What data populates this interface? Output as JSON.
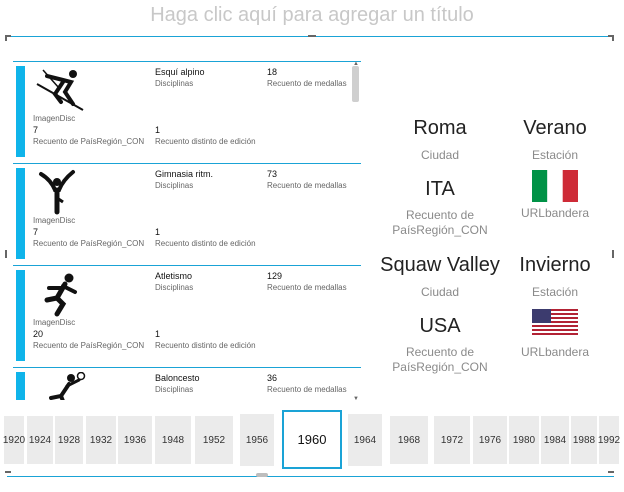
{
  "title_placeholder": "Haga clic aquí para agregar un título",
  "cards": [
    {
      "image_label": "ImagenDisc",
      "discipline": "Esquí alpino",
      "discipline_label": "Disciplinas",
      "medals": "18",
      "medals_label": "Recuento de medallas",
      "countries": "7",
      "countries_label": "Recuento de PaísRegión_CON",
      "editions": "1",
      "editions_label": "Recuento distinto de edición",
      "icon": "alpine-skiing-icon"
    },
    {
      "image_label": "ImagenDisc",
      "discipline": "Gimnasia ritm.",
      "discipline_label": "Disciplinas",
      "medals": "73",
      "medals_label": "Recuento de medallas",
      "countries": "7",
      "countries_label": "Recuento de PaísRegión_CON",
      "editions": "1",
      "editions_label": "Recuento distinto de edición",
      "icon": "rhythmic-gymnastics-icon"
    },
    {
      "image_label": "ImagenDisc",
      "discipline": "Atletismo",
      "discipline_label": "Disciplinas",
      "medals": "129",
      "medals_label": "Recuento de medallas",
      "countries": "20",
      "countries_label": "Recuento de PaísRegión_CON",
      "editions": "1",
      "editions_label": "Recuento distinto de edición",
      "icon": "athletics-icon"
    },
    {
      "image_label": "ImagenDisc",
      "discipline": "Baloncesto",
      "discipline_label": "Disciplinas",
      "medals": "36",
      "medals_label": "Recuento de medallas",
      "countries": "",
      "countries_label": "",
      "editions": "",
      "editions_label": "",
      "icon": "basketball-icon"
    }
  ],
  "details": [
    {
      "city": "Roma",
      "city_label": "Ciudad",
      "season": "Verano",
      "season_label": "Estación",
      "noc": "ITA",
      "noc_label_1": "Recuento de",
      "noc_label_2": "PaísRegión_CON",
      "flag_label": "URLbandera",
      "flag": "italy-flag-icon"
    },
    {
      "city": "Squaw Valley",
      "city_label": "Ciudad",
      "season": "Invierno",
      "season_label": "Estación",
      "noc": "USA",
      "noc_label_1": "Recuento de",
      "noc_label_2": "PaísRegión_CON",
      "flag_label": "URLbandera",
      "flag": "usa-flag-icon"
    }
  ],
  "years": [
    "1920",
    "1924",
    "1928",
    "1932",
    "1936",
    "1948",
    "1952",
    "1956",
    "1960",
    "1964",
    "1968",
    "1972",
    "1976",
    "1980",
    "1984",
    "1988",
    "1992"
  ],
  "selected_year": "1960",
  "colors": {
    "accent": "#0fb4ea",
    "frame": "#1aa3d6",
    "italy_green": "#009246",
    "italy_red": "#ce2b37",
    "usa_red": "#b22234",
    "usa_blue": "#3c3b6e"
  }
}
